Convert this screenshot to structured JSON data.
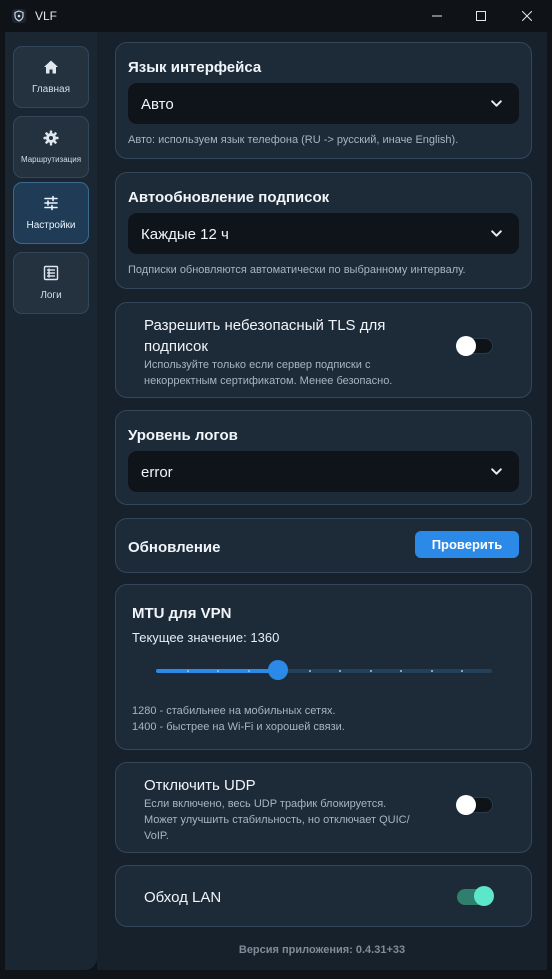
{
  "window": {
    "title": "VLF"
  },
  "sidebar": {
    "items": [
      {
        "label": "Главная",
        "icon": "home-icon"
      },
      {
        "label": "Маршрутизация",
        "icon": "gear-icon"
      },
      {
        "label": "Настройки",
        "icon": "sliders-icon"
      },
      {
        "label": "Логи",
        "icon": "log-list-icon"
      }
    ],
    "active": "Настройки"
  },
  "settings": {
    "language": {
      "title": "Язык интерфейса",
      "value": "Авто",
      "hint": "Авто: используем язык телефона (RU -> русский, иначе English)."
    },
    "auto_update": {
      "title": "Автообновление подписок",
      "value": "Каждые 12 ч",
      "hint": "Подписки обновляются автоматически по выбранному интервалу."
    },
    "insecure_tls": {
      "title_line1": "Разрешить небезопасный TLS для",
      "title_line2": "подписок",
      "hint_line1": "Используйте только если сервер подписки с",
      "hint_line2": "некорректным сертификатом. Менее безопасно.",
      "enabled": false
    },
    "log_level": {
      "title": "Уровень логов",
      "value": "error"
    },
    "update": {
      "title": "Обновление",
      "button": "Проверить"
    },
    "mtu": {
      "title": "MTU для VPN",
      "current_label": "Текущее значение: 1360",
      "current": 1360,
      "min": 1280,
      "max": 1500,
      "hint_line1": "1280 - стабильнее на мобильных сетях.",
      "hint_line2": "1400 - быстрее на Wi-Fi и хорошей связи."
    },
    "disable_udp": {
      "title": "Отключить UDP",
      "hint_line1": "Если включено, весь UDP трафик блокируется.",
      "hint_line2": "Может улучшить стабильность, но отключает QUIC/",
      "hint_line3": "VoIP.",
      "enabled": false
    },
    "lan_bypass": {
      "title": "Обход LAN",
      "enabled": true
    }
  },
  "footer": {
    "version": "Версия приложения: 0.4.31+33"
  },
  "colors": {
    "accent": "#2b8ae8",
    "toggle_on": "#5ce7c9",
    "card": "#1d2b39",
    "background": "#16212b"
  }
}
